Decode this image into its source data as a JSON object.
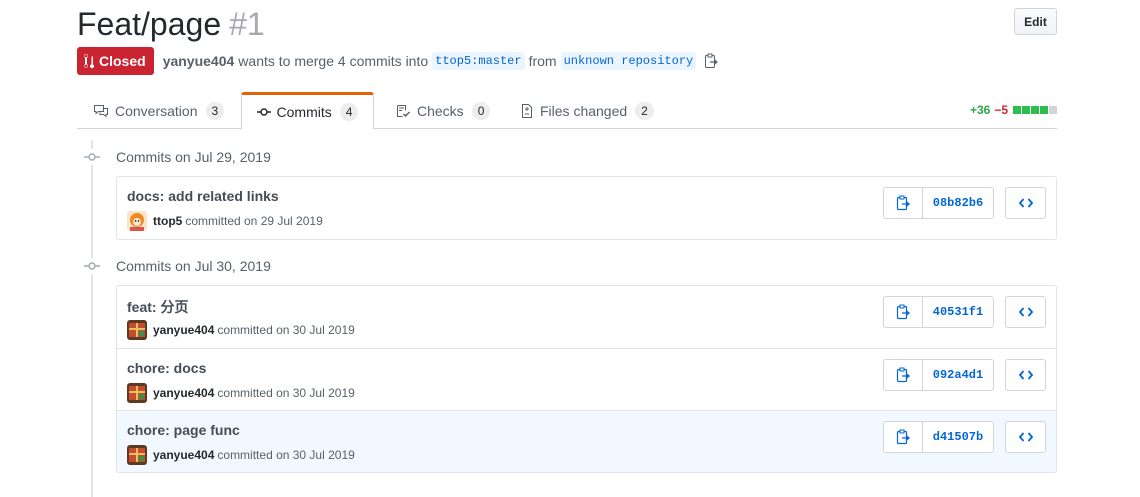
{
  "pr": {
    "title": "Feat/page",
    "number": "#1",
    "edit_label": "Edit",
    "state": "Closed",
    "author": "yanyue404",
    "merge_text": "wants to merge 4 commits into",
    "base_branch": "ttop5:master",
    "from_text": "from",
    "head_branch": "unknown repository"
  },
  "tabs": [
    {
      "label": "Conversation",
      "count": "3",
      "icon": "comment-discussion-icon"
    },
    {
      "label": "Commits",
      "count": "4",
      "icon": "git-commit-icon",
      "selected": true
    },
    {
      "label": "Checks",
      "count": "0",
      "icon": "checklist-icon"
    },
    {
      "label": "Files changed",
      "count": "2",
      "icon": "file-diff-icon"
    }
  ],
  "diffstat": {
    "additions": "+36",
    "deletions": "−5"
  },
  "colors": {
    "closed": "#cb2431",
    "link": "#0366d6",
    "added": "#28a745",
    "tab_accent": "#e36209"
  },
  "groups": [
    {
      "date_label": "Commits on Jul 29, 2019",
      "commits": [
        {
          "message": "docs: add related links",
          "author": "ttop5",
          "committed_text": "committed on 29 Jul 2019",
          "sha": "08b82b6"
        }
      ]
    },
    {
      "date_label": "Commits on Jul 30, 2019",
      "commits": [
        {
          "message": "feat: 分页",
          "author": "yanyue404",
          "committed_text": "committed on 30 Jul 2019",
          "sha": "40531f1"
        },
        {
          "message": "chore: docs",
          "author": "yanyue404",
          "committed_text": "committed on 30 Jul 2019",
          "sha": "092a4d1"
        },
        {
          "message": "chore: page func",
          "author": "yanyue404",
          "committed_text": "committed on 30 Jul 2019",
          "sha": "d41507b"
        }
      ]
    }
  ]
}
